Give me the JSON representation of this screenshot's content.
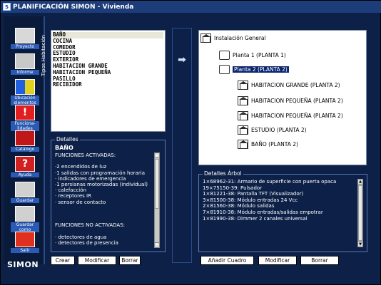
{
  "window": {
    "title": "PLANIFICACIÓN SIMON - Vivienda",
    "icon_letter": "S"
  },
  "toolbar": {
    "items": [
      {
        "label": "Proyecto",
        "icon": "folder-icon"
      },
      {
        "label": "Informe",
        "icon": "printer-icon"
      },
      {
        "label": "Ubicación elementos",
        "icon": "location-icon"
      },
      {
        "label": "Funciona-lidades",
        "icon": "exclamation-icon"
      },
      {
        "label": "Catálogo",
        "icon": "book-icon"
      },
      {
        "label": "Ayuda",
        "icon": "help-icon"
      },
      {
        "label": "Guardar",
        "icon": "floppy-icon"
      },
      {
        "label": "Guardar como",
        "icon": "floppy-as-icon"
      },
      {
        "label": "Salir",
        "icon": "exit-icon"
      }
    ],
    "logo": "SIMON"
  },
  "left": {
    "tipos_label": "Tipos Habitación",
    "room_types": [
      "BAÑO",
      "COCINA",
      "COMEDOR",
      "ESTUDIO",
      "EXTERIOR",
      "HABITACION GRANDE",
      "HABITACION PEQUEÑA",
      "PASILLO",
      "RECIBIDOR"
    ],
    "selected_index": 0,
    "details_title": "Detalles",
    "details_name": "BAÑO",
    "details_text": "FUNCIONES ACTIVADAS:\n\n·2 encendidos de luz\n·1 salidas con programación horaria\n· indicadores de emergencia\n·1 persianas motorizadas (individual)\n· calefacción\n· receptores IR\n· sensor de contacto\n\n\n\nFUNCIONES NO ACTIVADAS:\n\n· detectores de agua\n· detectores de presencia",
    "buttons": {
      "crear": "Crear",
      "modificar": "Modificar",
      "borrar": "Borrar"
    }
  },
  "right": {
    "tree": {
      "root": "Instalación General",
      "floors": [
        "Planta 1 (PLANTA 1)",
        "Planta 2 (PLANTA 2)"
      ],
      "rooms": [
        "HABITACION GRANDE (PLANTA 2)",
        "HABITACION PEQUEÑA (PLANTA 2)",
        "HABITACION PEQUEÑA (PLANTA 2)",
        "ESTUDIO (PLANTA 2)",
        "BAÑO (PLANTA 2)"
      ]
    },
    "arbol_title": "Detalles Árbol",
    "arbol_text": "1×68962-31: Armario de superficie con puerta opaca\n19×75150-39: Pulsador\n1×81221-38: Pantalla TFT (Visualizador)\n3×81500-38: Módulo entradas 24 Vcc\n2×81560-38: Módulo salidas\n7×81910-38: Módulo entradas/salidas empotrar\n1×81990-38: Dimmer 2 canales universal",
    "buttons": {
      "anadir": "Añadir Cuadro",
      "modificar": "Modificar",
      "borrar": "Borrar"
    }
  }
}
